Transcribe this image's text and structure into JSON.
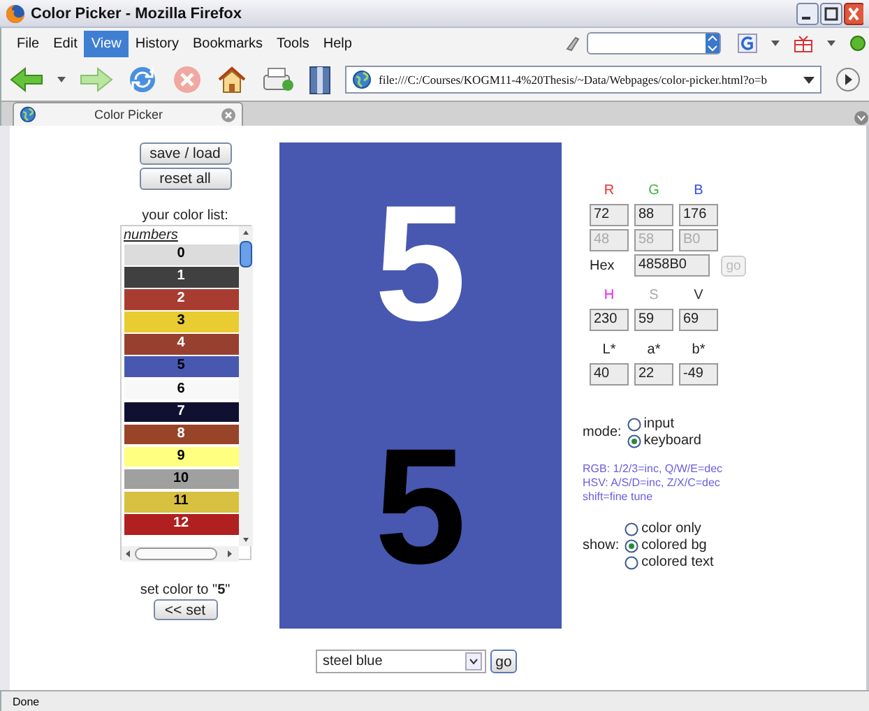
{
  "window": {
    "title": "Color Picker - Mozilla Firefox"
  },
  "menu": [
    {
      "label": "File",
      "selected": false
    },
    {
      "label": "Edit",
      "selected": false
    },
    {
      "label": "View",
      "selected": true
    },
    {
      "label": "History",
      "selected": false
    },
    {
      "label": "Bookmarks",
      "selected": false
    },
    {
      "label": "Tools",
      "selected": false
    },
    {
      "label": "Help",
      "selected": false
    }
  ],
  "address_bar": {
    "url": "file:///C:/Courses/KOGM11-4%20Thesis/~Data/Webpages/color-picker.html?o=b"
  },
  "tabs": [
    {
      "label": "Color Picker",
      "selected": true
    }
  ],
  "page": {
    "buttons": [
      "save / load",
      "reset all"
    ],
    "list_label": "your color list:",
    "list_header": "numbers",
    "list_items": [
      {
        "label": "0",
        "color": "#dcdcdc",
        "dark_text": true
      },
      {
        "label": "1",
        "color": "#404040",
        "dark_text": false
      },
      {
        "label": "2",
        "color": "#a83c30",
        "dark_text": false
      },
      {
        "label": "3",
        "color": "#e8cc30",
        "dark_text": true
      },
      {
        "label": "4",
        "color": "#984030",
        "dark_text": false
      },
      {
        "label": "5",
        "color": "#4858b0",
        "dark_text": true
      },
      {
        "label": "6",
        "color": "#f8f8f8",
        "dark_text": true
      },
      {
        "label": "7",
        "color": "#101030",
        "dark_text": false
      },
      {
        "label": "8",
        "color": "#984428",
        "dark_text": false
      },
      {
        "label": "9",
        "color": "#ffff80",
        "dark_text": true
      },
      {
        "label": "10",
        "color": "#a0a0a0",
        "dark_text": true
      },
      {
        "label": "11",
        "color": "#d8c040",
        "dark_text": true
      },
      {
        "label": "12",
        "color": "#b02020",
        "dark_text": false
      }
    ],
    "set_label": "set color to \"**5**\"",
    "set_button": "<< set",
    "preview": {
      "top_text": "5",
      "bottom_text": "5"
    },
    "rgb": {
      "labels": [
        "R",
        "G",
        "B"
      ],
      "values": [
        {
          "value": "72",
          "disabled": false
        },
        {
          "value": "88",
          "disabled": false
        },
        {
          "value": "176",
          "disabled": false
        }
      ],
      "hex_parts": [
        {
          "value": "48",
          "disabled": true
        },
        {
          "value": "58",
          "disabled": true
        },
        {
          "value": "B0",
          "disabled": true
        }
      ]
    },
    "hex": {
      "label": "Hex",
      "value": "4858B0",
      "button": "go",
      "button_disabled": true
    },
    "hsv": {
      "labels": [
        "H",
        "S",
        "V"
      ],
      "values": [
        "230",
        "59",
        "69"
      ]
    },
    "lab": {
      "labels": [
        "L*",
        "a*",
        "b*"
      ],
      "values": [
        "40",
        "22",
        "-49"
      ]
    },
    "mode": {
      "label": "mode:",
      "options": [
        {
          "label": "input",
          "selected": false
        },
        {
          "label": "keyboard",
          "selected": true
        }
      ]
    },
    "help": [
      "RGB: 1/2/3=inc, Q/W/E=dec",
      "HSV: A/S/D=inc, Z/X/C=dec",
      "shift=fine tune"
    ],
    "show": {
      "label": "show:",
      "options": [
        {
          "label": "color only",
          "selected": false
        },
        {
          "label": "colored bg",
          "selected": true
        },
        {
          "label": "colored text",
          "selected": false
        }
      ]
    },
    "color_select": {
      "value": "steel blue"
    },
    "go_button": "go"
  },
  "status_bar": {
    "text": "Done"
  }
}
